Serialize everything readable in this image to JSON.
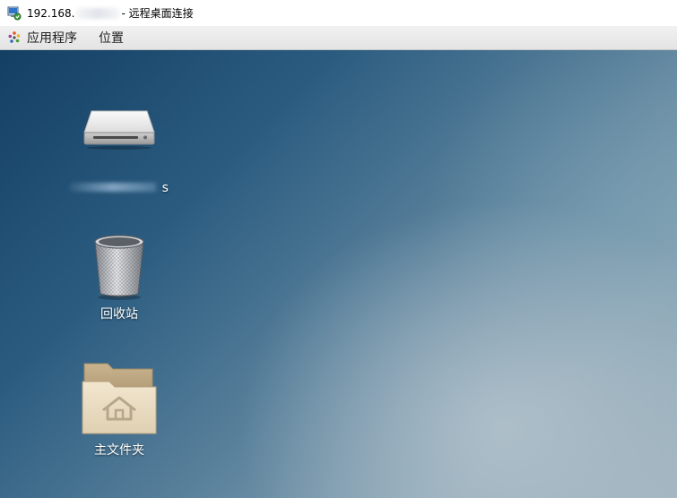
{
  "window": {
    "title_prefix": "192.168.",
    "title_suffix": "- 远程桌面连接"
  },
  "menubar": {
    "applications_label": "应用程序",
    "places_label": "位置"
  },
  "desktop": {
    "icons": [
      {
        "name": "drive",
        "label_suffix": "s"
      },
      {
        "name": "trash",
        "label": "回收站"
      },
      {
        "name": "home",
        "label": "主文件夹"
      }
    ]
  },
  "colors": {
    "desktop_top_left": "#133f63",
    "desktop_bottom_right": "#9fb3bf",
    "panel": "#e8e8e8"
  }
}
